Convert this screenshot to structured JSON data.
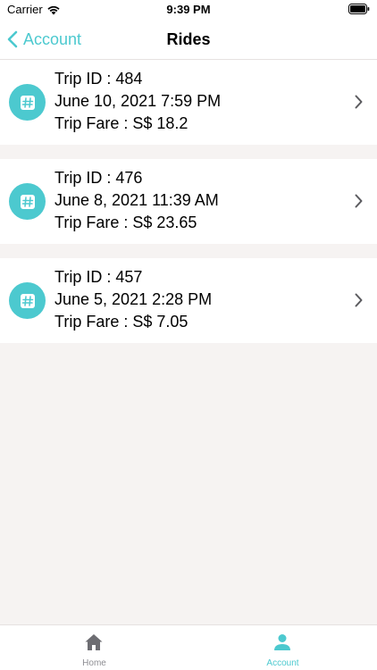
{
  "status_bar": {
    "carrier": "Carrier",
    "time": "9:39 PM"
  },
  "nav": {
    "back_label": "Account",
    "title": "Rides"
  },
  "rides": [
    {
      "trip_id": "Trip ID : 484",
      "datetime": "June 10, 2021 7:59 PM",
      "fare": "Trip Fare : S$ 18.2"
    },
    {
      "trip_id": "Trip ID : 476",
      "datetime": "June 8, 2021 11:39 AM",
      "fare": "Trip Fare : S$ 23.65"
    },
    {
      "trip_id": "Trip ID : 457",
      "datetime": "June 5, 2021 2:28 PM",
      "fare": "Trip Fare : S$ 7.05"
    }
  ],
  "tab_bar": {
    "home_label": "Home",
    "account_label": "Account",
    "active_tab": "Account"
  },
  "icons": {
    "back": "chevron-left-icon",
    "ride": "hashtag-icon",
    "disclosure": "chevron-right-icon",
    "home": "house-icon",
    "account": "person-icon"
  },
  "colors": {
    "accent": "#4cc9cf",
    "background": "#f6f3f2",
    "inactive_tab": "#8e8e93"
  }
}
